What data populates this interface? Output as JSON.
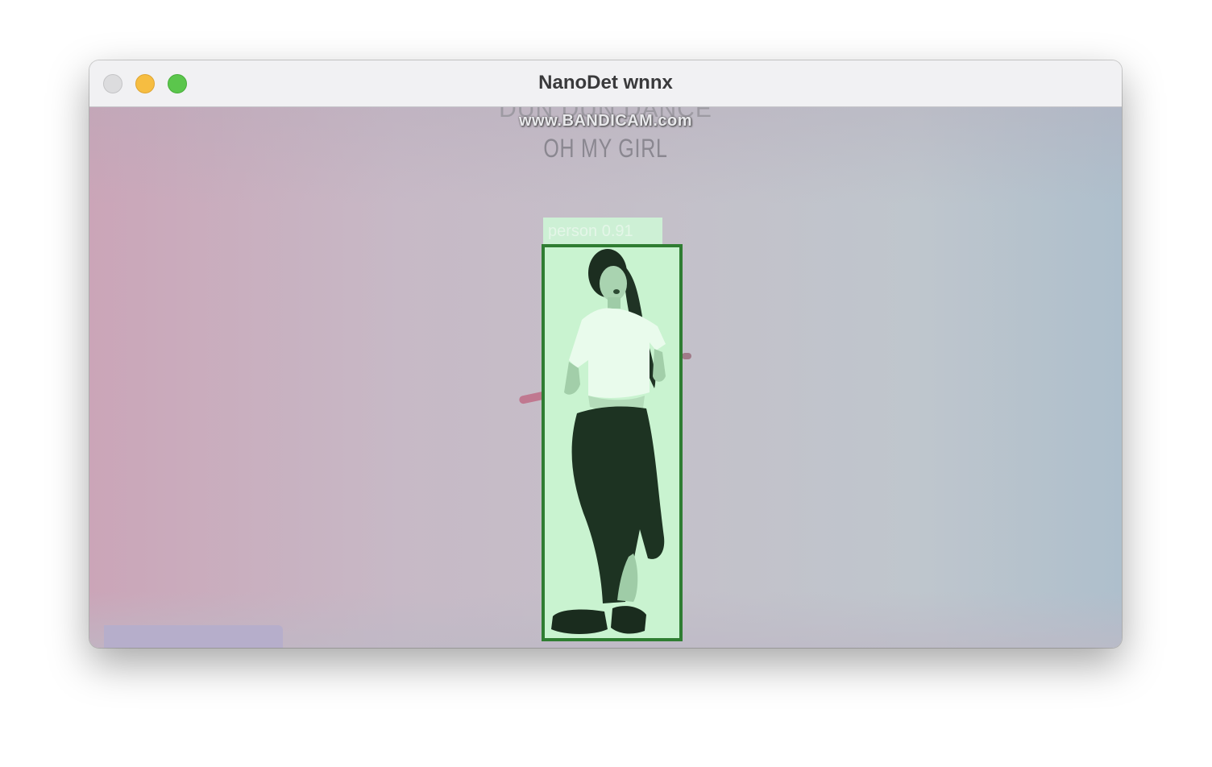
{
  "window": {
    "title": "NanoDet wnnx"
  },
  "video": {
    "song_title": "DUN DUN DANCE",
    "watermark": "www.BANDICAM.com",
    "artist": "OH MY GIRL"
  },
  "detection": {
    "label": "person 0.91",
    "color": "#2f7d32",
    "fill": "#c9f3d0"
  },
  "icons": {
    "close": "close-window-icon",
    "minimize": "minimize-window-icon",
    "maximize": "maximize-window-icon"
  }
}
